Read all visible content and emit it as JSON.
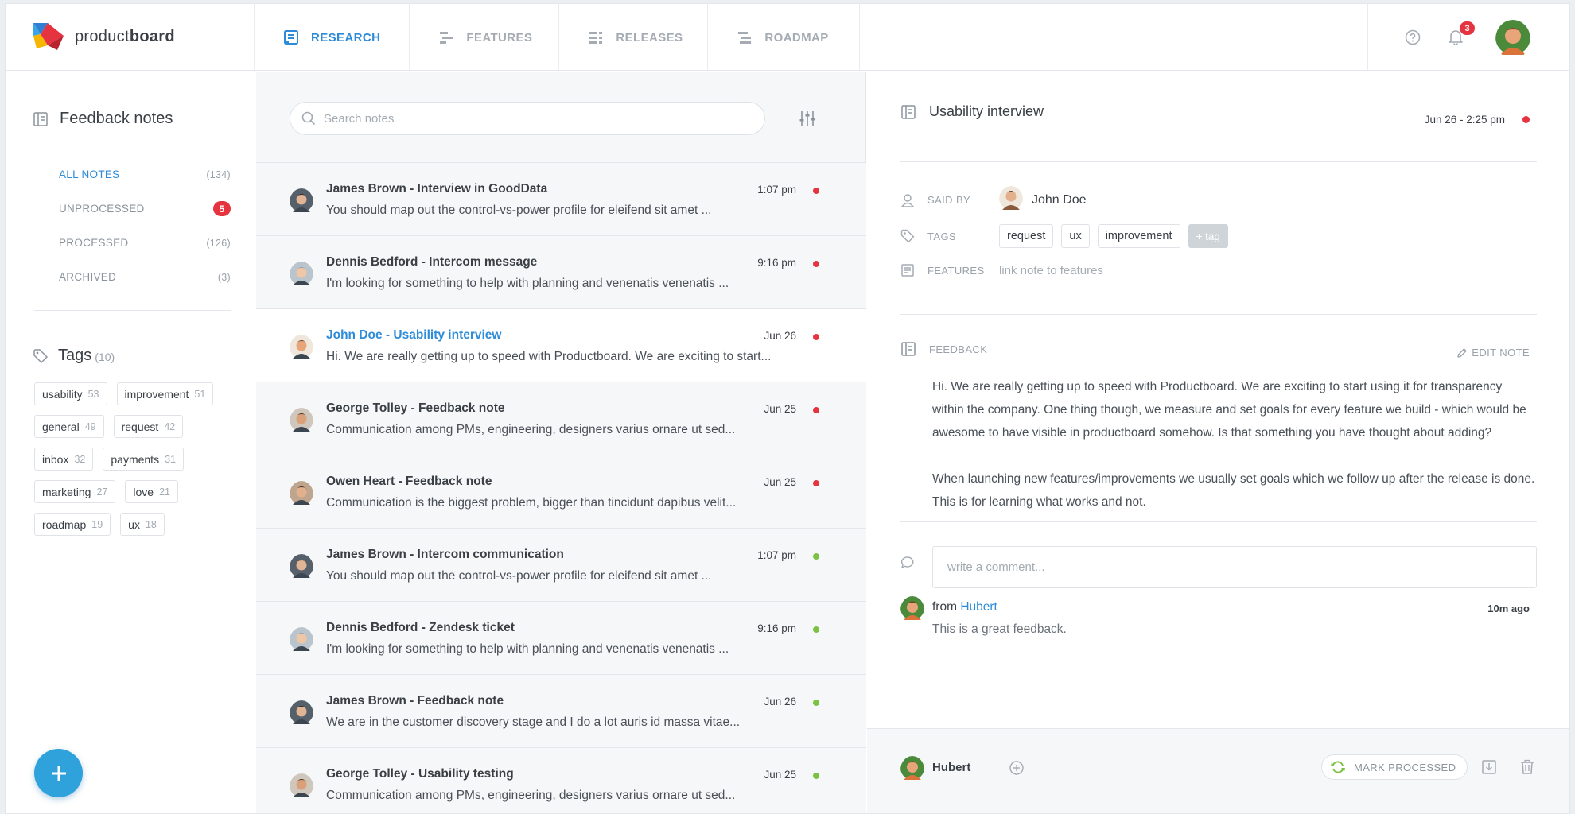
{
  "brand": {
    "name_light": "product",
    "name_bold": "board"
  },
  "nav": {
    "tabs": [
      {
        "label": "RESEARCH",
        "icon": "research-icon",
        "active": true
      },
      {
        "label": "FEATURES",
        "icon": "features-icon",
        "active": false
      },
      {
        "label": "RELEASES",
        "icon": "releases-icon",
        "active": false
      },
      {
        "label": "ROADMAP",
        "icon": "roadmap-icon",
        "active": false
      }
    ],
    "notification_count": "3"
  },
  "sidebar": {
    "title": "Feedback notes",
    "filters": [
      {
        "label": "ALL NOTES",
        "count": "(134)",
        "active": true
      },
      {
        "label": "UNPROCESSED",
        "count": "5",
        "badge": true
      },
      {
        "label": "PROCESSED",
        "count": "(126)"
      },
      {
        "label": "ARCHIVED",
        "count": "(3)"
      }
    ],
    "tags_title": "Tags",
    "tags_count": "(10)",
    "tags": [
      {
        "name": "usability",
        "count": "53"
      },
      {
        "name": "improvement",
        "count": "51"
      },
      {
        "name": "general",
        "count": "49"
      },
      {
        "name": "request",
        "count": "42"
      },
      {
        "name": "inbox",
        "count": "32"
      },
      {
        "name": "payments",
        "count": "31"
      },
      {
        "name": "marketing",
        "count": "27"
      },
      {
        "name": "love",
        "count": "21"
      },
      {
        "name": "roadmap",
        "count": "19"
      },
      {
        "name": "ux",
        "count": "18"
      }
    ],
    "add_button": "+"
  },
  "notes": {
    "search_placeholder": "Search notes",
    "items": [
      {
        "title": "James Brown - Interview in GoodData",
        "time": "1:07 pm",
        "status": "unprocessed",
        "snippet": "You should map out the control-vs-power profile for eleifend sit amet ..."
      },
      {
        "title": "Dennis Bedford - Intercom message",
        "time": "9:16 pm",
        "status": "unprocessed",
        "snippet": "I'm looking for something to help with planning and venenatis venenatis ..."
      },
      {
        "title": "John Doe - Usability interview",
        "time": "Jun 26",
        "status": "unprocessed",
        "active": true,
        "snippet": "Hi. We are really getting up to speed with Productboard. We are exciting to start..."
      },
      {
        "title": "George Tolley - Feedback note",
        "time": "Jun 25",
        "status": "unprocessed",
        "snippet": "Communication among PMs, engineering, designers varius ornare ut sed..."
      },
      {
        "title": "Owen Heart - Feedback note",
        "time": "Jun 25",
        "status": "unprocessed",
        "snippet": "Communication is the biggest problem, bigger than tincidunt dapibus velit..."
      },
      {
        "title": "James Brown - Intercom communication",
        "time": "1:07 pm",
        "status": "processed",
        "snippet": "You should map out the control-vs-power profile for eleifend sit amet ..."
      },
      {
        "title": "Dennis Bedford - Zendesk ticket",
        "time": "9:16 pm",
        "status": "processed",
        "snippet": "I'm looking for something to help with planning and venenatis venenatis ..."
      },
      {
        "title": "James Brown - Feedback note",
        "time": "Jun 26",
        "status": "processed",
        "snippet": "We are in the customer discovery stage and I do a lot auris id massa vitae..."
      },
      {
        "title": "George Tolley - Usability testing",
        "time": "Jun 25",
        "status": "processed",
        "snippet": "Communication among PMs, engineering, designers varius ornare ut sed..."
      }
    ]
  },
  "detail": {
    "title": "Usability interview",
    "date": "Jun 26 - 2:25 pm",
    "said_by_label": "SAID BY",
    "said_by": "John Doe",
    "tags_label": "TAGS",
    "tags": [
      "request",
      "ux",
      "improvement"
    ],
    "add_tag": "+ tag",
    "features_label": "FEATURES",
    "features_link": "link note to features",
    "feedback_label": "FEEDBACK",
    "edit_label": "EDIT NOTE",
    "feedback_p1": "Hi. We are really getting up to speed with Productboard. We are exciting to start using it for transparency within the company. One thing though, we measure and set goals for every feature we build - which would be awesome to have visible in productboard somehow. Is that something you have thought about adding?",
    "feedback_p2": "When launching new features/improvements we usually set goals which we follow up after the release is done. This is for learning what works and not.",
    "comment_placeholder": "write a comment...",
    "comment": {
      "from_prefix": "from",
      "author": "Hubert",
      "time": "10m ago",
      "text": "This is a great feedback."
    },
    "footer": {
      "user": "Hubert",
      "mark_processed": "MARK PROCESSED"
    }
  },
  "colors": {
    "accent": "#2e8bd8",
    "unprocessed_dot": "#e5333f",
    "processed_dot": "#7cc242",
    "fab": "#2fa2dc"
  }
}
